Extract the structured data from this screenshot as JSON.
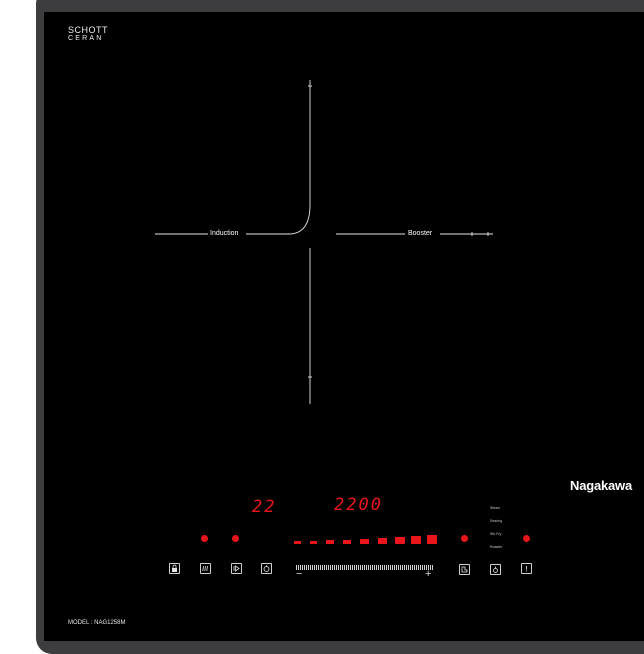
{
  "brand": {
    "top_line1": "SCHOTT",
    "top_line2": "CERAN",
    "name": "Nagakawa"
  },
  "zones": {
    "induction_label": "Induction",
    "booster_label": "Booster"
  },
  "display": {
    "left_value": "22",
    "right_value": "2200",
    "color": "#e8161b"
  },
  "modes": [
    "Steam",
    "Searing",
    "Stir Fry",
    "Roaster"
  ],
  "controls": {
    "lock_icon": "lock-icon",
    "heat_icon": "heat-waves-icon",
    "play_pause_icon": "play-pause-icon",
    "timer_icon": "timer-icon",
    "zone_select_icon": "zone-select-icon",
    "cook_mode_icon": "cook-mode-icon",
    "info_icon": "info-icon",
    "minus": "−",
    "plus": "+"
  },
  "power_level": {
    "lit_segments": 9,
    "total_segments": 9
  },
  "model_label": "MODEL : NAG1258M",
  "colors": {
    "glass": "#000000",
    "frame": "#3d3d3f",
    "indicator": "#e8161b"
  }
}
